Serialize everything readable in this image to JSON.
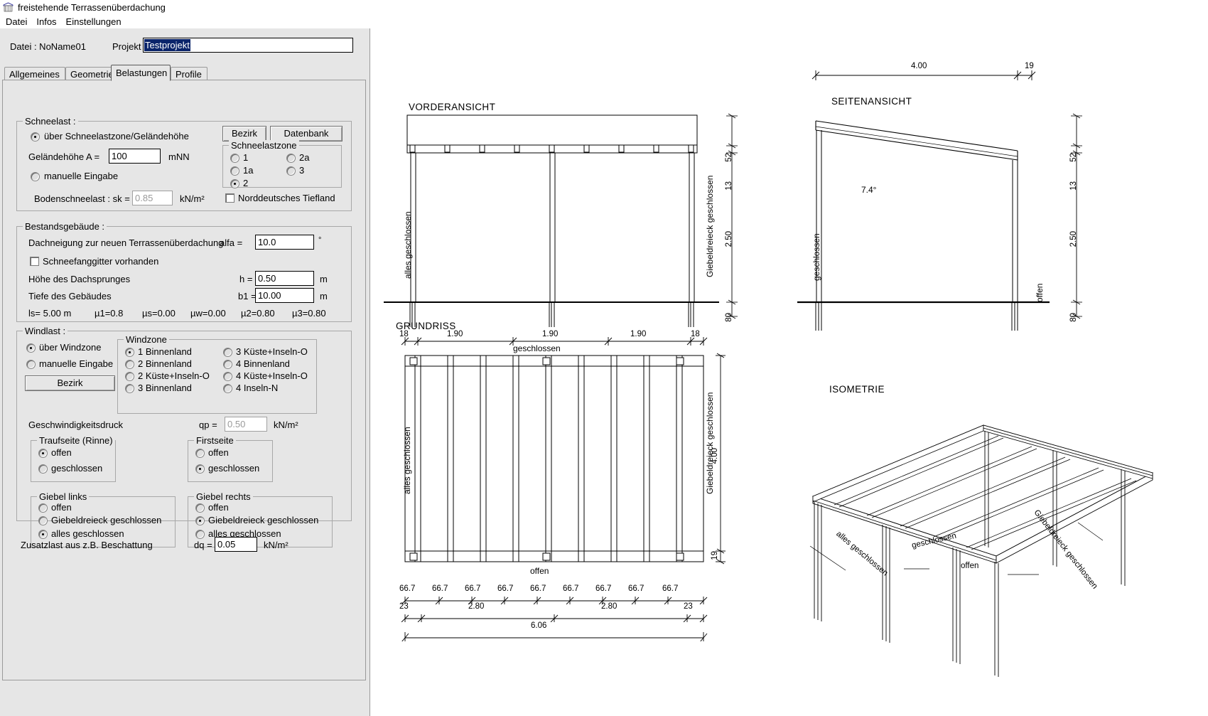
{
  "window": {
    "title": "freistehende Terrassenüberdachung",
    "app_icon": "window-icon"
  },
  "menubar": {
    "items": [
      "Datei",
      "Infos",
      "Einstellungen"
    ]
  },
  "filebar": {
    "datei_label": "Datei :  NoName01",
    "projekt_label": "Projekt :",
    "projekt_value": "Testprojekt"
  },
  "tabs": [
    {
      "label": "Allgemeines",
      "active": false
    },
    {
      "label": "Geometrie",
      "active": false
    },
    {
      "label": "Belastungen",
      "active": true
    },
    {
      "label": "Profile",
      "active": false
    }
  ],
  "snow": {
    "caption": "Schneelast :",
    "mode_zone_label": "über Schneelastzone/Geländehöhe",
    "mode_manual_label": "manuelle Eingabe",
    "gelaendehoehe_label": "Geländehöhe  A =",
    "gelaendehoehe_value": "100",
    "gelaendehoehe_unit": "mNN",
    "bodenschneelast_label": "Bodenschneelast :  sk =",
    "bodenschneelast_value": "0.85",
    "bodenschneelast_unit": "kN/m²",
    "btn_bezirk": "Bezirk",
    "btn_datenbank": "Datenbank",
    "zone_caption": "Schneelastzone",
    "zones": [
      "1",
      "1a",
      "2",
      "2a",
      "3"
    ],
    "zone_selected": "2",
    "tiefland_label": "Norddeutsches Tiefland",
    "tiefland_checked": false
  },
  "building": {
    "caption": "Bestandsgebäude :",
    "alfa_label": "Dachneigung zur neuen Terrassenüberdachung",
    "alfa_symbol": "alfa =",
    "alfa_value": "10.0",
    "alfa_unit": "°",
    "snowguard_label": "Schneefanggitter vorhanden",
    "snowguard_checked": false,
    "h_label": "Höhe des Dachsprunges",
    "h_symbol": "h =",
    "h_value": "0.50",
    "h_unit": "m",
    "b1_label": "Tiefe des Gebäudes",
    "b1_symbol": "b1 =",
    "b1_value": "10.00",
    "b1_unit": "m",
    "results": [
      "ls= 5.00   m",
      "µ1=0.8",
      "µs=0.00",
      "µw=0.00",
      "µ2=0.80",
      "µ3=0.80"
    ]
  },
  "wind": {
    "caption": "Windlast :",
    "mode_zone_label": "über Windzone",
    "mode_manual_label": "manuelle Eingabe",
    "btn_bezirk": "Bezirk",
    "zone_caption": "Windzone",
    "zones_left": [
      "1 Binnenland",
      "2 Binnenland",
      "2 Küste+Inseln-O",
      "3 Binnenland"
    ],
    "zones_right": [
      "3 Küste+Inseln-O",
      "4 Binnenland",
      "4 Küste+Inseln-O",
      "4 Inseln-N"
    ],
    "zone_selected": "1 Binnenland",
    "qp_label": "Geschwindigkeitsdruck",
    "qp_symbol": "qp =",
    "qp_value": "0.50",
    "qp_unit": "kN/m²",
    "traufseite": {
      "caption": "Traufseite (Rinne)",
      "options": [
        "offen",
        "geschlossen"
      ],
      "selected": "offen"
    },
    "firstseite": {
      "caption": "Firstseite",
      "options": [
        "offen",
        "geschlossen"
      ],
      "selected": "geschlossen"
    },
    "giebel_links": {
      "caption": "Giebel links",
      "options": [
        "offen",
        "Giebeldreieck geschlossen",
        "alles geschlossen"
      ],
      "selected": "alles geschlossen"
    },
    "giebel_rechts": {
      "caption": "Giebel rechts",
      "options": [
        "offen",
        "Giebeldreieck geschlossen",
        "alles geschlossen"
      ],
      "selected": "Giebeldreieck geschlossen"
    }
  },
  "extra": {
    "label": "Zusatzlast aus z.B. Beschattung",
    "symbol": "dq =",
    "value": "0.05",
    "unit": "kN/m²"
  },
  "drawing": {
    "views": {
      "front": {
        "title": "VORDERANSICHT",
        "left_label": "alles geschlossen",
        "right_label": "Giebeldreieck geschlossen",
        "dims": [
          "13",
          "52",
          "2.50",
          "80"
        ]
      },
      "side": {
        "title": "SEITENANSICHT",
        "top_dims": [
          "4.00",
          "19"
        ],
        "left_label": "geschlossen",
        "right_label": "offen",
        "angle_label": "7.4°",
        "dims": [
          "13",
          "52",
          "2.50",
          "80"
        ]
      },
      "plan": {
        "title": "GRUNDRISS",
        "top_dims": [
          "18",
          "1.90",
          "1.90",
          "1.90",
          "18"
        ],
        "top_label": "geschlossen",
        "bottom_label": "offen",
        "left_label": "alles geschlossen",
        "right_label": "Giebeldreieck geschlossen",
        "right_dims": [
          "4.00",
          "19"
        ],
        "rafter_dims": [
          "66.7",
          "66.7",
          "66.7",
          "66.7",
          "66.7",
          "66.7",
          "66.7",
          "66.7",
          "66.7"
        ],
        "mid_dims": [
          "23",
          "2.80",
          "2.80",
          "23"
        ],
        "total_dim": "6.06"
      },
      "iso": {
        "title": "ISOMETRIE",
        "labels": [
          "alles geschlossen",
          "geschlossen",
          "offen",
          "Giebeldreieck geschlossen"
        ]
      }
    }
  },
  "colors": {
    "form_bg": "#e6e6e6",
    "selection_blue": "#0a246a",
    "line": "#000000"
  }
}
